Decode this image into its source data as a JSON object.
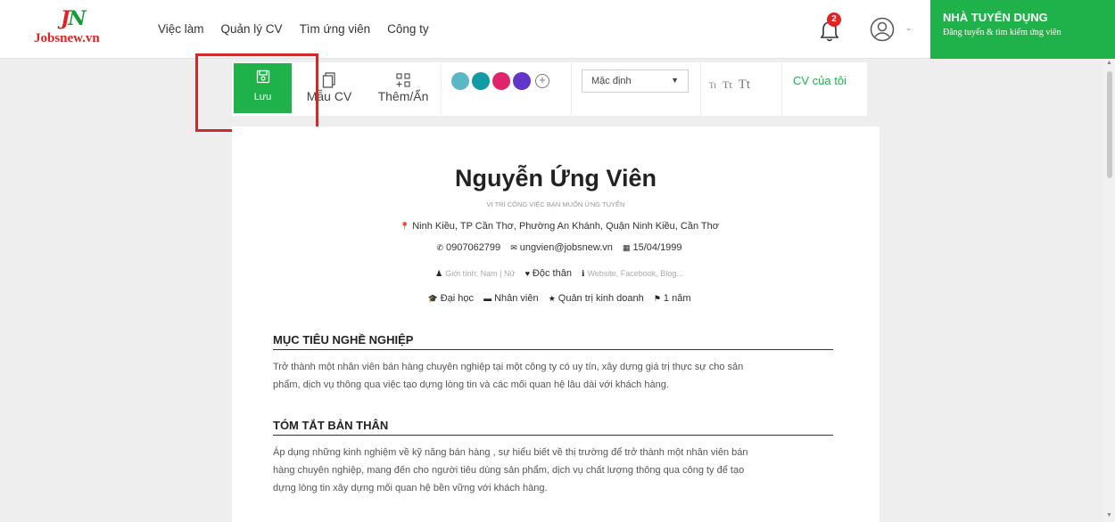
{
  "header": {
    "logo_text": "Jobsnew.vn",
    "nav": [
      "Việc làm",
      "Quản lý CV",
      "Tìm ứng viên",
      "Công ty"
    ],
    "notification_count": "2",
    "employer_title": "NHÀ TUYỂN DỤNG",
    "employer_subtitle": "Đăng tuyển & tìm kiếm ứng viên",
    "brand_color": "#1fb24a"
  },
  "toolbar": {
    "save_label": "Lưu",
    "template_label": "Mẫu CV",
    "addhide_label": "Thêm/Ẩn",
    "colors": [
      "#5bb7c4",
      "#129aa5",
      "#e0246b",
      "#6236c9"
    ],
    "font_select_value": "Mặc định",
    "font_sizes": [
      "Tt",
      "Tt",
      "Tt"
    ],
    "my_cv_label": "CV của tôi"
  },
  "cv": {
    "name": "Nguyễn Ứng Viên",
    "position_placeholder": "VỊ TRÍ CÔNG VIỆC BẠN MUỐN ỨNG TUYỂN",
    "address": "Ninh Kiều, TP Cần Thơ, Phường An Khánh, Quận Ninh Kiều, Cần Thơ",
    "phone": "0907062799",
    "email": "ungvien@jobsnew.vn",
    "birthday": "15/04/1999",
    "gender_placeholder": "Giới tính: Nam | Nữ",
    "marital": "Độc thân",
    "website_placeholder": "Website, Facebook, Blog...",
    "education": "Đại học",
    "level": "Nhân viên",
    "major": "Quản trị kinh doanh",
    "experience": "1 năm",
    "sections": [
      {
        "title": "MỤC TIÊU NGHỀ NGHIỆP",
        "lines": [
          "Trở thành một nhân viên bán hàng chuyên nghiệp tại một công ty có uy tín, xây dựng giá trị thực sự cho sản",
          "phẩm, dịch vụ thông qua việc tạo dựng lòng tin và các mối quan hệ lâu dài với khách hàng."
        ]
      },
      {
        "title": "TÓM TẮT BẢN THÂN",
        "lines": [
          "Áp dụng những kinh nghiệm về kỹ năng bán hàng , sự hiểu biết về thị trường để trở thành một nhân viên bán",
          "hàng chuyên nghiệp, mang đến cho người tiêu dùng sản phẩm, dịch vụ chất lượng thông qua công ty để tạo",
          "dựng lòng tin xây dựng mối quan hệ bền vững với khách hàng."
        ]
      }
    ]
  }
}
